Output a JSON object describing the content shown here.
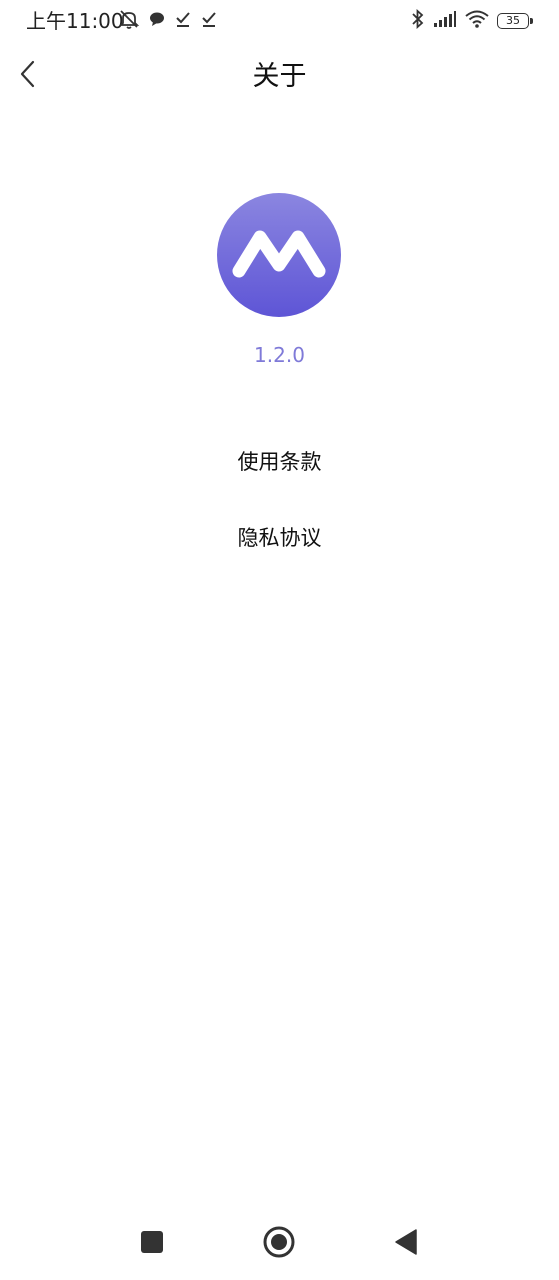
{
  "status_bar": {
    "time": "上午11:00",
    "battery_level": "35",
    "left_icons": [
      "notification-off-icon",
      "chat-bubble-icon",
      "check-download-icon",
      "check-download-icon"
    ],
    "right_icons": [
      "bluetooth-icon",
      "signal-icon",
      "wifi-icon",
      "battery-icon"
    ]
  },
  "header": {
    "title": "关于",
    "back_icon": "chevron-left-icon"
  },
  "app": {
    "logo_icon": "app-logo-m-icon",
    "version": "1.2.0",
    "colors": {
      "logo_top": "#8b86e0",
      "logo_bottom": "#5e55d6",
      "version_text": "#7f7ad8"
    }
  },
  "links": {
    "terms": "使用条款",
    "privacy": "隐私协议"
  },
  "nav_bar": {
    "recents_icon": "square-icon",
    "home_icon": "circle-home-icon",
    "back_icon": "triangle-back-icon"
  }
}
